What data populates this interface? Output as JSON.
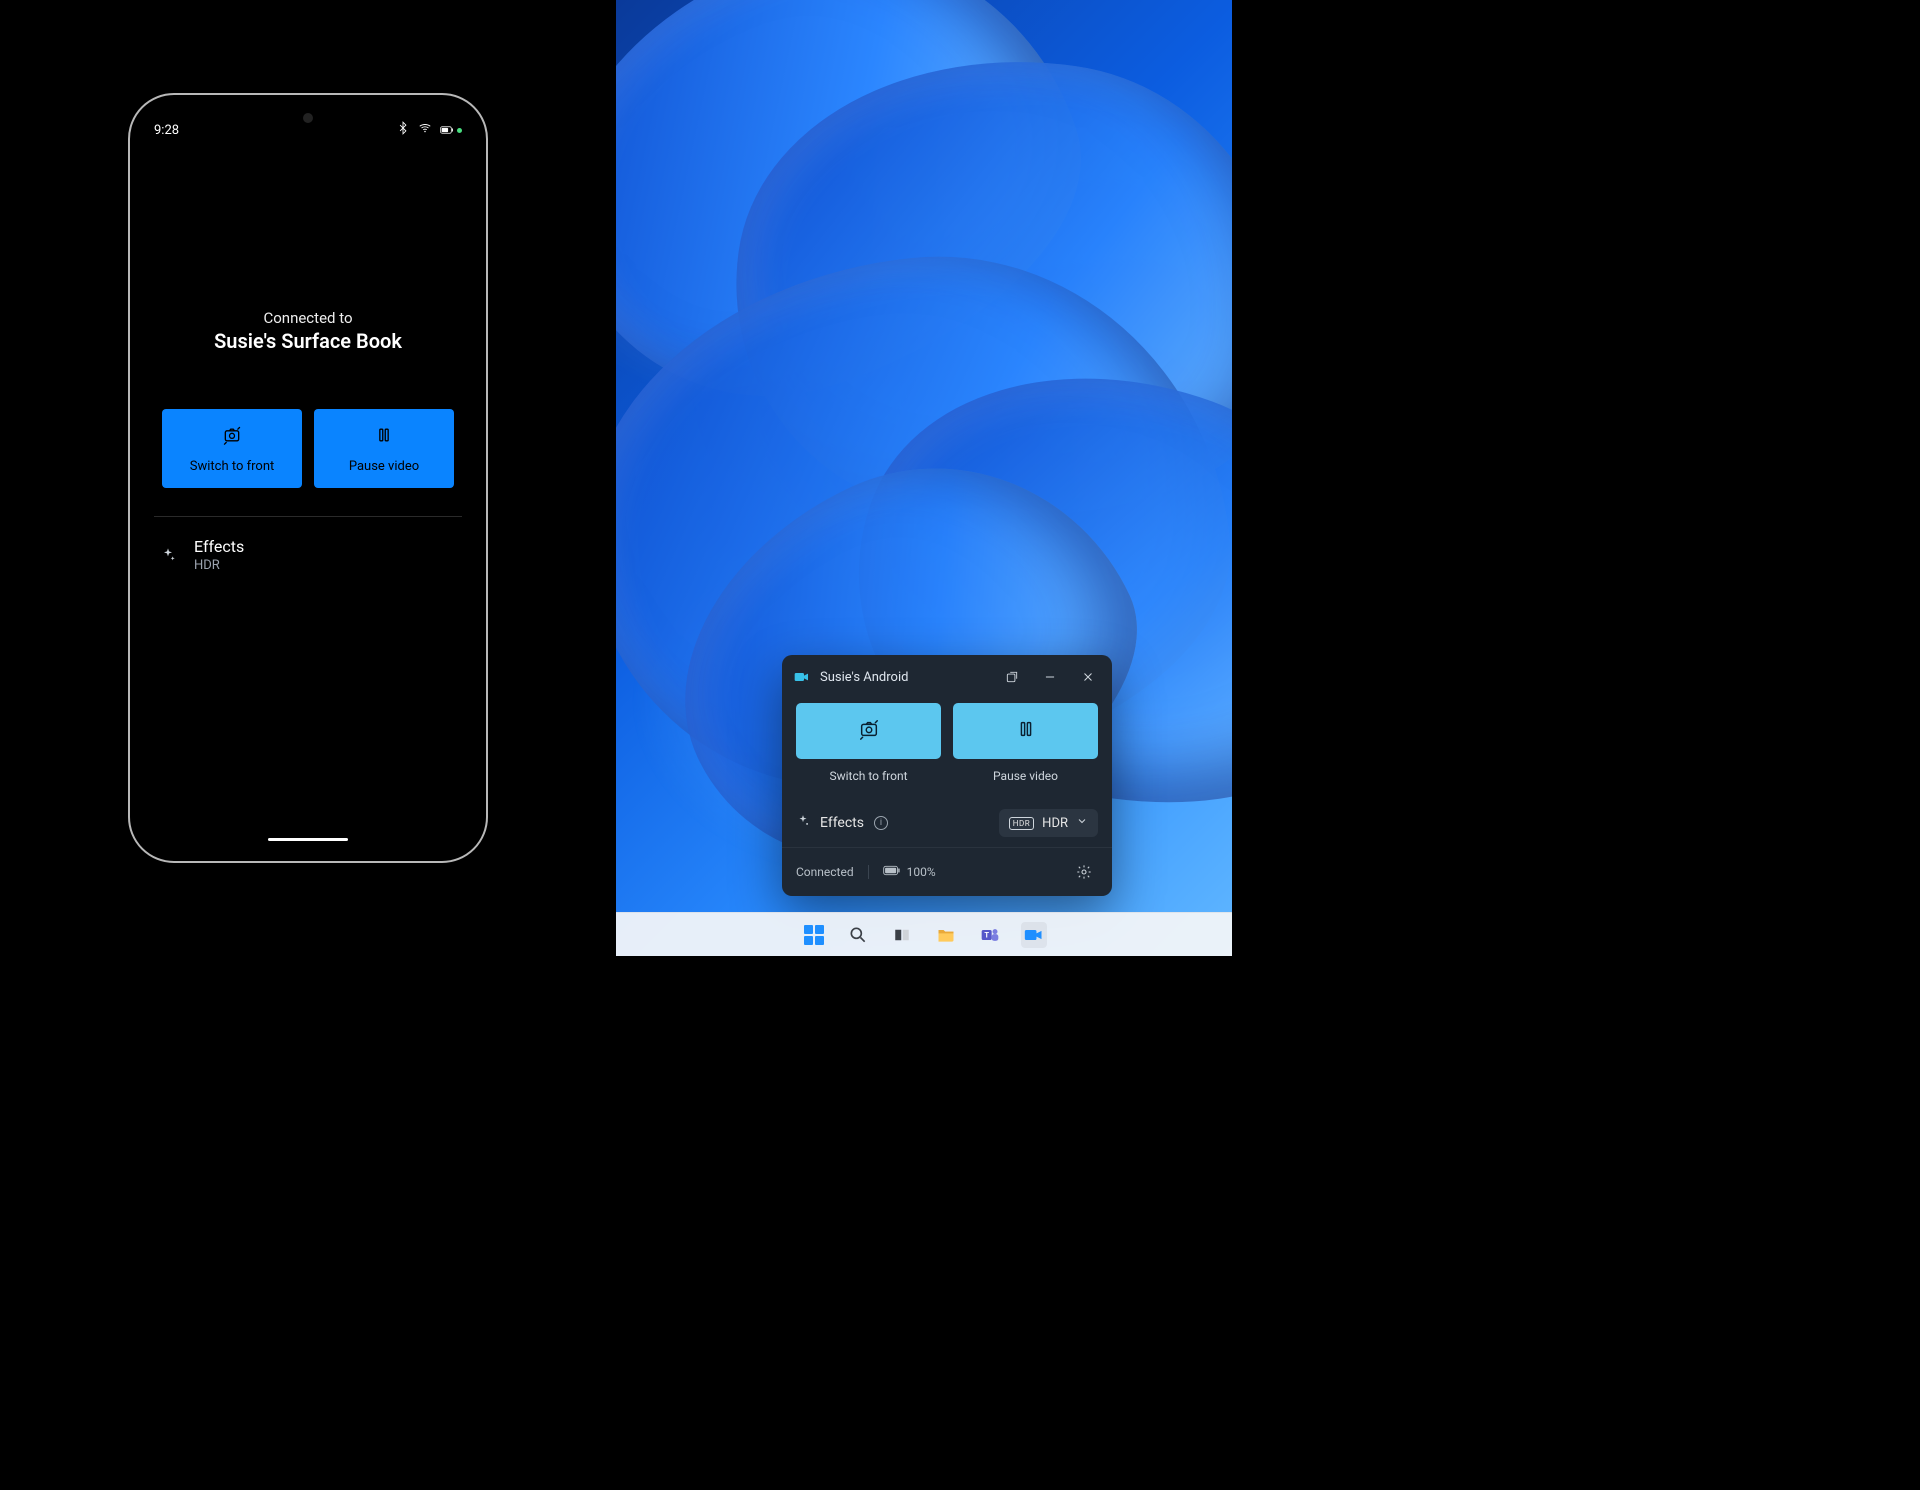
{
  "phone": {
    "status": {
      "time": "9:28"
    },
    "connected": {
      "prefix": "Connected to",
      "device": "Susie's Surface Book"
    },
    "buttons": {
      "switch": "Switch to front",
      "pause": "Pause video"
    },
    "effects": {
      "title": "Effects",
      "mode": "HDR"
    }
  },
  "windows": {
    "flyout": {
      "title": "Susie's Android",
      "buttons": {
        "switch": "Switch to front",
        "pause": "Pause video"
      },
      "effects_label": "Effects",
      "hdr_label": "HDR",
      "status": "Connected",
      "battery": "100%"
    }
  }
}
